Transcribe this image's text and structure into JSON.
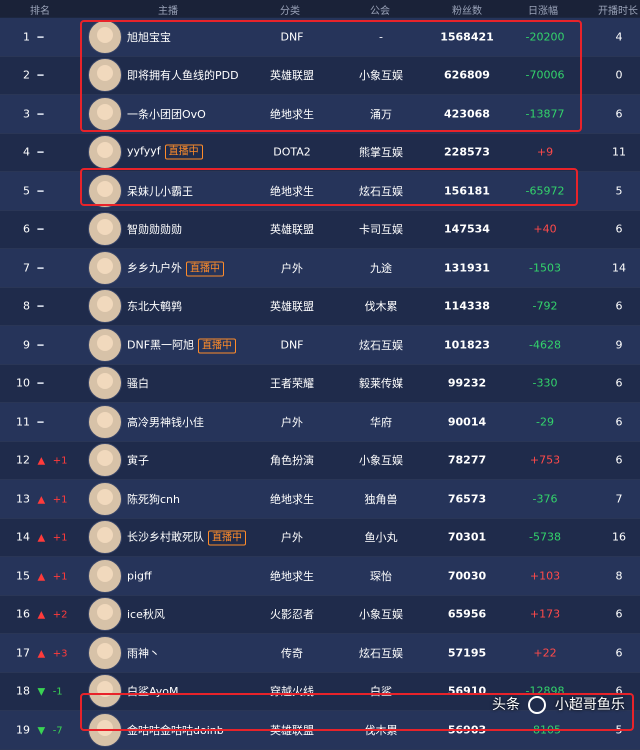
{
  "columns": {
    "rank": "排名",
    "anchor": "主播",
    "category": "分类",
    "guild": "公会",
    "fans": "粉丝数",
    "daily_change": "日涨幅",
    "hours": "开播时长"
  },
  "rows": [
    {
      "rank": "1",
      "trend": "same",
      "delta": "",
      "name": "旭旭宝宝",
      "live": false,
      "category": "DNF",
      "guild": "-",
      "fans": "1568421",
      "change": "-20200",
      "change_dir": "neg",
      "hours": "4"
    },
    {
      "rank": "2",
      "trend": "same",
      "delta": "",
      "name": "即将拥有人鱼线的PDD",
      "live": false,
      "category": "英雄联盟",
      "guild": "小象互娱",
      "fans": "626809",
      "change": "-70006",
      "change_dir": "neg",
      "hours": "0"
    },
    {
      "rank": "3",
      "trend": "same",
      "delta": "",
      "name": "一条小团团OvO",
      "live": false,
      "category": "绝地求生",
      "guild": "涌万",
      "fans": "423068",
      "change": "-13877",
      "change_dir": "neg",
      "hours": "6"
    },
    {
      "rank": "4",
      "trend": "same",
      "delta": "",
      "name": "yyfyyf",
      "live": true,
      "category": "DOTA2",
      "guild": "熊掌互娱",
      "fans": "228573",
      "change": "+9",
      "change_dir": "pos",
      "hours": "11"
    },
    {
      "rank": "5",
      "trend": "same",
      "delta": "",
      "name": "呆妹儿小霸王",
      "live": false,
      "category": "绝地求生",
      "guild": "炫石互娱",
      "fans": "156181",
      "change": "-65972",
      "change_dir": "neg",
      "hours": "5"
    },
    {
      "rank": "6",
      "trend": "same",
      "delta": "",
      "name": "智勋勋勋勋",
      "live": false,
      "category": "英雄联盟",
      "guild": "卡司互娱",
      "fans": "147534",
      "change": "+40",
      "change_dir": "pos",
      "hours": "6"
    },
    {
      "rank": "7",
      "trend": "same",
      "delta": "",
      "name": "乡乡九户外",
      "live": true,
      "category": "户外",
      "guild": "九途",
      "fans": "131931",
      "change": "-1503",
      "change_dir": "neg",
      "hours": "14"
    },
    {
      "rank": "8",
      "trend": "same",
      "delta": "",
      "name": "东北大鹌鹑",
      "live": false,
      "category": "英雄联盟",
      "guild": "伐木累",
      "fans": "114338",
      "change": "-792",
      "change_dir": "neg",
      "hours": "6"
    },
    {
      "rank": "9",
      "trend": "same",
      "delta": "",
      "name": "DNF黑一阿旭",
      "live": true,
      "category": "DNF",
      "guild": "炫石互娱",
      "fans": "101823",
      "change": "-4628",
      "change_dir": "neg",
      "hours": "9"
    },
    {
      "rank": "10",
      "trend": "same",
      "delta": "",
      "name": "骚白",
      "live": false,
      "category": "王者荣耀",
      "guild": "毅莱传媒",
      "fans": "99232",
      "change": "-330",
      "change_dir": "neg",
      "hours": "6"
    },
    {
      "rank": "11",
      "trend": "same",
      "delta": "",
      "name": "高冷男神钱小佳",
      "live": false,
      "category": "户外",
      "guild": "华府",
      "fans": "90014",
      "change": "-29",
      "change_dir": "neg",
      "hours": "6"
    },
    {
      "rank": "12",
      "trend": "up",
      "delta": "+1",
      "name": "寅子",
      "live": false,
      "category": "角色扮演",
      "guild": "小象互娱",
      "fans": "78277",
      "change": "+753",
      "change_dir": "pos",
      "hours": "6"
    },
    {
      "rank": "13",
      "trend": "up",
      "delta": "+1",
      "name": "陈死狗cnh",
      "live": false,
      "category": "绝地求生",
      "guild": "独角兽",
      "fans": "76573",
      "change": "-376",
      "change_dir": "neg",
      "hours": "7"
    },
    {
      "rank": "14",
      "trend": "up",
      "delta": "+1",
      "name": "长沙乡村敢死队",
      "live": true,
      "category": "户外",
      "guild": "鱼小丸",
      "fans": "70301",
      "change": "-5738",
      "change_dir": "neg",
      "hours": "16"
    },
    {
      "rank": "15",
      "trend": "up",
      "delta": "+1",
      "name": "pigff",
      "live": false,
      "category": "绝地求生",
      "guild": "琛怡",
      "fans": "70030",
      "change": "+103",
      "change_dir": "pos",
      "hours": "8"
    },
    {
      "rank": "16",
      "trend": "up",
      "delta": "+2",
      "name": "ice秋风",
      "live": false,
      "category": "火影忍者",
      "guild": "小象互娱",
      "fans": "65956",
      "change": "+173",
      "change_dir": "pos",
      "hours": "6"
    },
    {
      "rank": "17",
      "trend": "up",
      "delta": "+3",
      "name": "雨神丶",
      "live": false,
      "category": "传奇",
      "guild": "炫石互娱",
      "fans": "57195",
      "change": "+22",
      "change_dir": "pos",
      "hours": "6"
    },
    {
      "rank": "18",
      "trend": "down",
      "delta": "-1",
      "name": "白鲨AyoM",
      "live": false,
      "category": "穿越火线",
      "guild": "白鲨",
      "fans": "56910",
      "change": "-12898",
      "change_dir": "neg",
      "hours": "6"
    },
    {
      "rank": "19",
      "trend": "down",
      "delta": "-7",
      "name": "金咕咕金咕咕doinb",
      "live": false,
      "category": "英雄联盟",
      "guild": "伐木累",
      "fans": "56903",
      "change": "-8105",
      "change_dir": "neg",
      "hours": "5"
    }
  ],
  "live_badge": "直播中",
  "watermark": {
    "left": "头条",
    "right": "小超哥鱼乐"
  }
}
